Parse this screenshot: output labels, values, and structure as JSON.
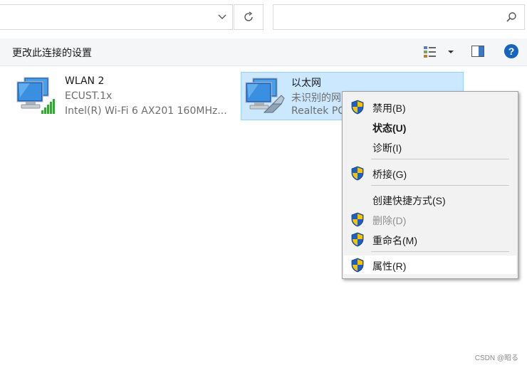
{
  "toolbar": {
    "command_label": "更改此连接的设置",
    "help_label": "?"
  },
  "adapters": [
    {
      "name": "WLAN 2",
      "status": "ECUST.1x",
      "device": "Intel(R) Wi-Fi 6 AX201 160MHz..."
    },
    {
      "name": "以太网",
      "status": "未识别的网",
      "device": "Realtek PC"
    }
  ],
  "context_menu": {
    "items": [
      {
        "label": "禁用(B)",
        "icon": "uac-shield-icon"
      },
      {
        "label": "状态(U)",
        "bold": true
      },
      {
        "label": "诊断(I)"
      },
      {
        "label": "桥接(G)",
        "icon": "uac-shield-icon"
      },
      {
        "label": "创建快捷方式(S)"
      },
      {
        "label": "删除(D)",
        "icon": "uac-shield-icon",
        "disabled": true
      },
      {
        "label": "重命名(M)",
        "icon": "uac-shield-icon"
      },
      {
        "label": "属性(R)",
        "icon": "uac-shield-icon",
        "highlighted": true
      }
    ]
  },
  "watermark": "CSDN @昭る",
  "colors": {
    "selection_bg": "#cce8ff",
    "selection_border": "#99d1ff",
    "help_blue": "#1565c0",
    "signal_green": "#3aa33a"
  }
}
